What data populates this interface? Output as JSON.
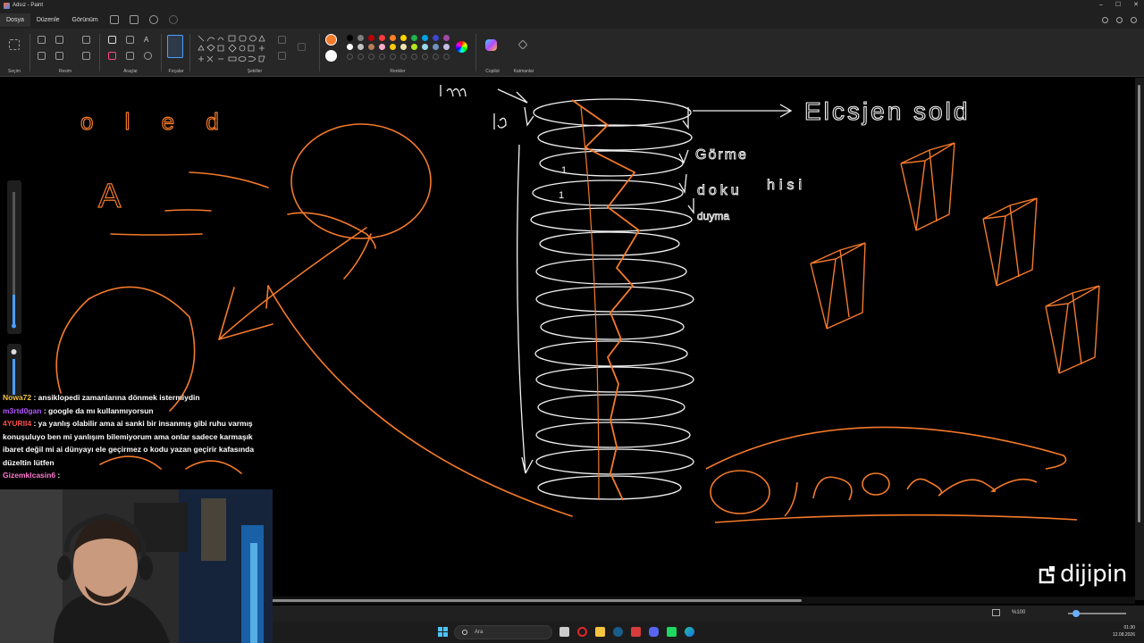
{
  "window": {
    "title": "Adsız - Paint",
    "controls": [
      "–",
      "☐",
      "✕"
    ]
  },
  "menu": {
    "items": [
      "Dosya",
      "Düzenle",
      "Görünüm"
    ]
  },
  "ribbon": {
    "groups": {
      "selection": "Seçim",
      "image": "Resim",
      "tools": "Araçlar",
      "brushes": "Fırçalar",
      "shapes": "Şekiller",
      "colors": "Renkler",
      "copilot": "Copilot",
      "layers": "Katmanlar"
    },
    "active_color": "#f47a2a",
    "secondary_color": "#ffffff",
    "palette_row1": [
      "#000000",
      "#7f7f7f",
      "#c00000",
      "#ff3b3b",
      "#ff7f27",
      "#ffd400",
      "#22b14c",
      "#00a2e8",
      "#3f48cc",
      "#a349a4"
    ],
    "palette_row2": [
      "#ffffff",
      "#c3c3c3",
      "#b97a57",
      "#ffaec9",
      "#ffc90e",
      "#efe4b0",
      "#b5e61d",
      "#99d9ea",
      "#7092be",
      "#c8bfe7"
    ]
  },
  "canvas": {
    "handwriting": {
      "top_left": "o l e d",
      "a_letter": "A",
      "one_m": "1m",
      "one_e": "1e",
      "one_a": "1",
      "one_b": "1",
      "right_top": "Elcsjen sold",
      "gorme": "Görme",
      "dokunma": "doku",
      "hissi": "hisi",
      "duyma": "duyma"
    }
  },
  "chat": {
    "messages": [
      {
        "user": "Nowa72",
        "user_color": "#f5c542",
        "text": " : ansiklopedi zamanlarına dönmek istermiydin"
      },
      {
        "user": "m3rtd0gan",
        "user_color": "#b455ff",
        "text": " : google da mı kullanmıyorsun"
      },
      {
        "user": "4YURII4",
        "user_color": "#ff4a4a",
        "text": " : ya yanlış olabilir ama ai sanki bir insanmış gibi ruhu varmış konuşuluyo ben mi yanlışım bilemiyorum ama onlar sadece karmaşık ibaret değil mi ai dünyayı ele geçirmez o kodu yazan geçirir kafasında düzeltin lütfen"
      },
      {
        "user": "Gizemklcasin6",
        "user_color": "#ff7ad0",
        "text": " :"
      }
    ]
  },
  "statusbar": {
    "zoom": "%100"
  },
  "taskbar": {
    "search_placeholder": "Ara",
    "time": "01:30",
    "date": "12.08.2026"
  },
  "watermark": {
    "text": "dijipin"
  }
}
